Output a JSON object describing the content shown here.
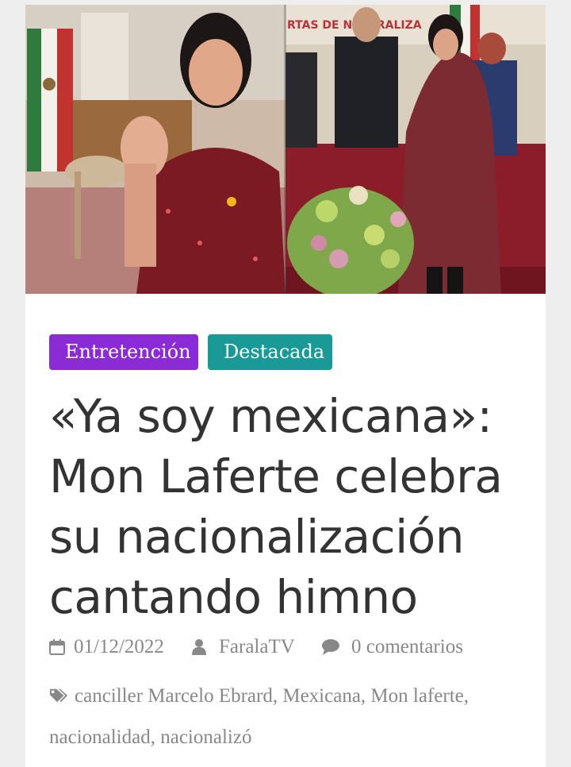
{
  "article": {
    "hero_image": "woman-waving-and-woman-singing-at-ceremony-photo",
    "hero_banner_text": "RTAS DE NATURALIZA",
    "categories": [
      {
        "label": "Entretención",
        "color": "#8a2bd6"
      },
      {
        "label": "Destacada",
        "color": "#1a9a97"
      }
    ],
    "title_lines": [
      "«Ya soy mexicana»:",
      "Mon Laferte celebra",
      "su nacionalización",
      "cantando himno"
    ],
    "meta": {
      "date_icon": "calendar-icon",
      "date": "01/12/2022",
      "author_icon": "user-icon",
      "author": "FaralaTV",
      "comments_icon": "comment-icon",
      "comments": "0 comentarios"
    },
    "tags_icon": "tags-icon",
    "tags": [
      "canciller Marcelo Ebrard",
      "Mexicana",
      "Mon laferte",
      "nacionalidad",
      "nacionalizó"
    ]
  }
}
